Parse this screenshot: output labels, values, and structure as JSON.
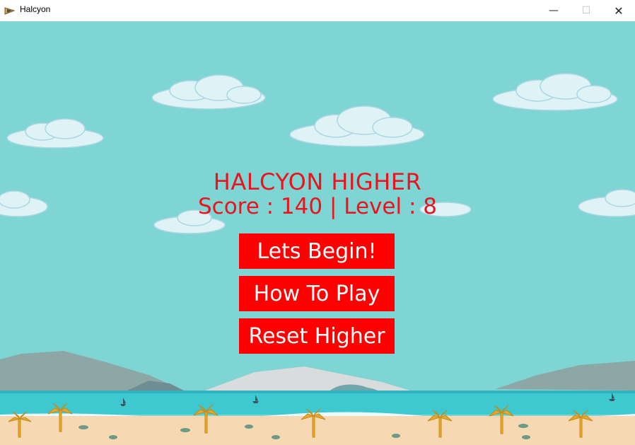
{
  "window": {
    "title": "Halcyon",
    "controls": {
      "minimize": "—",
      "maximize": "☐",
      "close": "✕"
    }
  },
  "game": {
    "title": "HALCYON HIGHER",
    "score_line": "Score : 140 | Level : 8",
    "buttons": {
      "begin": "Lets Begin!",
      "how_to": "How To Play",
      "reset": "Reset Higher"
    }
  },
  "colors": {
    "sky": "#7fd4d4",
    "text_red": "#e8141e",
    "button_red": "#ff0000",
    "button_text": "#ffffff",
    "sea": "#3cc8d0",
    "sand": "#f6d9b3"
  },
  "icons": {
    "app": "halcyon-app-icon",
    "minimize": "minimize-icon",
    "maximize": "maximize-icon",
    "close": "close-icon"
  }
}
